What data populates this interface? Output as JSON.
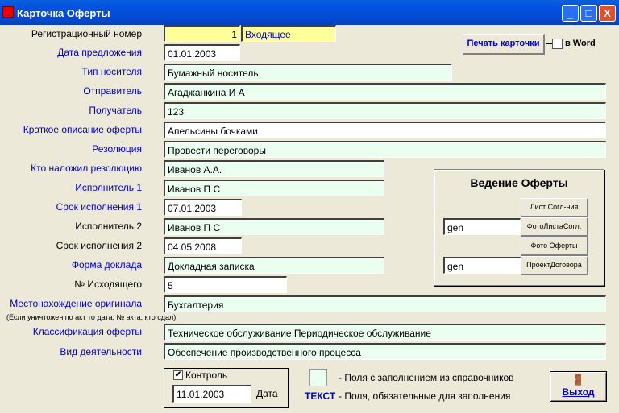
{
  "window": {
    "title": "Карточка Оферты",
    "minimize": "_",
    "maximize": "□",
    "close": "X"
  },
  "print": {
    "button": "Печать карточки",
    "word_label": "в Word",
    "word_checked": false
  },
  "fields": {
    "reg_label": "Регистрационный номер",
    "reg_number": "1",
    "reg_type": "Входящее",
    "date_label": "Дата предложения",
    "date": "01.01.2003",
    "carrier_label": "Тип носителя",
    "carrier": "Бумажный носитель",
    "sender_label": "Отправитель",
    "sender": "Агаджанкина И А",
    "recipient_label": "Получатель",
    "recipient": "123",
    "summary_label": "Краткое описание оферты",
    "summary": "Апельсины бочками",
    "resolution_label": "Резолюция",
    "resolution": "Провести переговоры",
    "resolver_label": "Кто наложил резолюцию",
    "resolver": "Иванов А.А.",
    "executor1_label": "Исполнитель 1",
    "executor1": "Иванов П С",
    "deadline1_label": "Срок исполнения 1",
    "deadline1": "07.01.2003",
    "executor2_label": "Исполнитель 2",
    "executor2": "Иванов П С",
    "deadline2_label": "Срок исполнения 2",
    "deadline2": "04.05.2008",
    "report_label": "Форма доклада",
    "report": "Докладная записка",
    "outgoing_label": "№ Исходящего",
    "outgoing": "5",
    "location_label": "Местонахождение оригинала",
    "location": "Бухгалтерия",
    "location_note": "(Если уничтожен по акт то дата, № акта, кто сдал)",
    "class_label": "Классификация оферты",
    "class": "Техническое обслуживание Периодическое обслуживание",
    "activity_label": "Вид деятельности",
    "activity": "Обеспечение производственного процесса"
  },
  "panel": {
    "title": "Ведение Оферты",
    "btn1": "Лист  Согл-ния",
    "btn2": "ФотоЛистаСогл.",
    "btn3": "Фото  Оферты",
    "btn4": "ПроектДоговора",
    "input1": "gen",
    "input2": "gen"
  },
  "control": {
    "label": "Контроль",
    "checked": true,
    "date": "11.01.2003",
    "date_label": "Дата"
  },
  "legend": {
    "ref_text": "-  Поля с заполнением из справочников",
    "req_sample": "ТЕКСТ",
    "req_text": "-  Поля, обязательные для заполнения"
  },
  "exit": {
    "label": "Выход"
  }
}
